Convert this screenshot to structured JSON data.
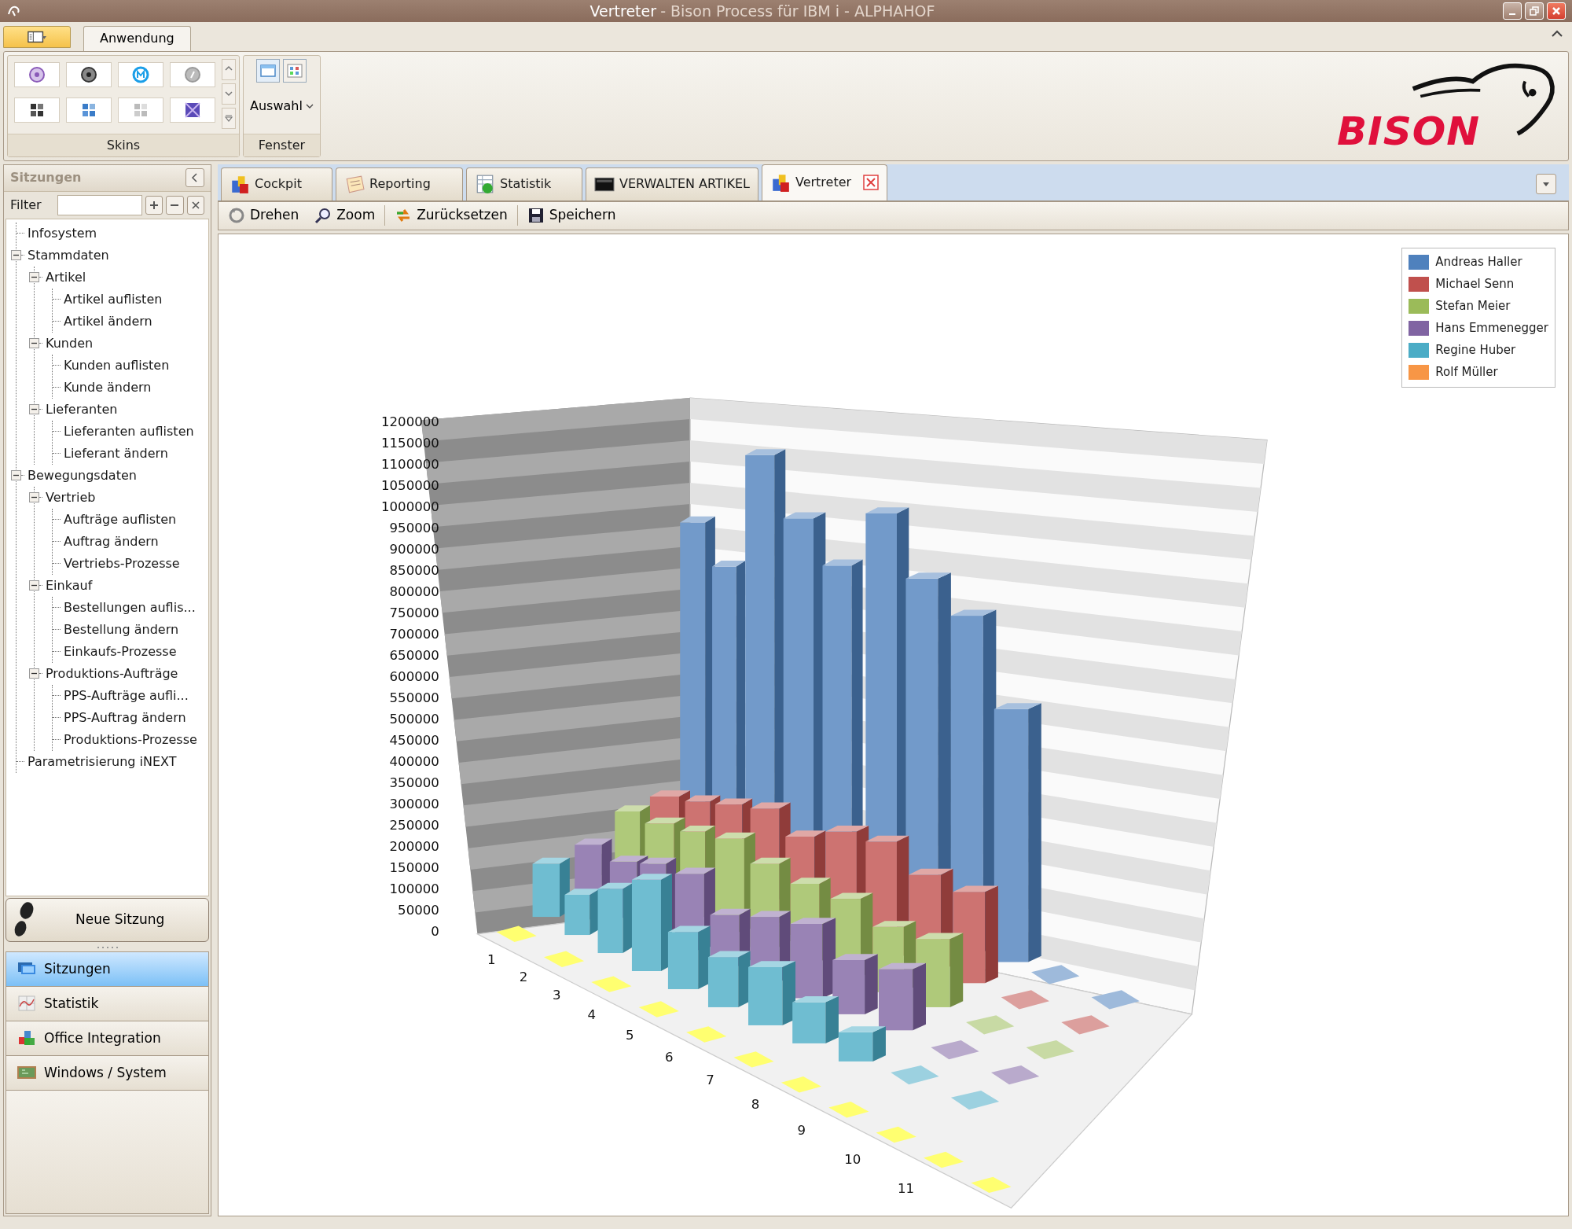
{
  "window": {
    "title": "Vertreter",
    "subtitle": "- Bison Process für IBM i - ALPHAHOF"
  },
  "ribbon": {
    "tabs": [
      {
        "label": "Anwendung",
        "selected": true
      }
    ],
    "groups": [
      {
        "label": "Skins"
      },
      {
        "label": "Fenster",
        "button": "Auswahl"
      }
    ],
    "logo": "BISON"
  },
  "sidebar": {
    "title": "Sitzungen",
    "filter_label": "Filter",
    "tree": [
      {
        "label": "Infosystem"
      },
      {
        "label": "Stammdaten",
        "expanded": true,
        "children": [
          {
            "label": "Artikel",
            "expanded": true,
            "children": [
              {
                "label": "Artikel auflisten"
              },
              {
                "label": "Artikel ändern"
              }
            ]
          },
          {
            "label": "Kunden",
            "expanded": true,
            "children": [
              {
                "label": "Kunden auflisten"
              },
              {
                "label": "Kunde ändern"
              }
            ]
          },
          {
            "label": "Lieferanten",
            "expanded": true,
            "children": [
              {
                "label": "Lieferanten auflisten"
              },
              {
                "label": "Lieferant ändern"
              }
            ]
          }
        ]
      },
      {
        "label": "Bewegungsdaten",
        "expanded": true,
        "children": [
          {
            "label": "Vertrieb",
            "expanded": true,
            "children": [
              {
                "label": "Aufträge auflisten"
              },
              {
                "label": "Auftrag ändern"
              },
              {
                "label": "Vertriebs-Prozesse"
              }
            ]
          },
          {
            "label": "Einkauf",
            "expanded": true,
            "children": [
              {
                "label": "Bestellungen auflis..."
              },
              {
                "label": "Bestellung ändern"
              },
              {
                "label": "Einkaufs-Prozesse"
              }
            ]
          },
          {
            "label": "Produktions-Aufträge",
            "expanded": true,
            "children": [
              {
                "label": "PPS-Aufträge aufli..."
              },
              {
                "label": "PPS-Auftrag ändern"
              },
              {
                "label": "Produktions-Prozesse"
              }
            ]
          }
        ]
      },
      {
        "label": "Parametrisierung iNEXT"
      }
    ],
    "new_session": "Neue Sitzung",
    "nav": [
      {
        "label": "Sitzungen",
        "selected": true
      },
      {
        "label": "Statistik",
        "selected": false
      },
      {
        "label": "Office Integration",
        "selected": false
      },
      {
        "label": "Windows / System",
        "selected": false
      }
    ]
  },
  "document_tabs": [
    {
      "label": "Cockpit",
      "selected": false,
      "closable": false
    },
    {
      "label": "Reporting",
      "selected": false,
      "closable": false
    },
    {
      "label": "Statistik",
      "selected": false,
      "closable": false
    },
    {
      "label": "VERWALTEN ARTIKEL",
      "selected": false,
      "closable": false
    },
    {
      "label": "Vertreter",
      "selected": true,
      "closable": true
    }
  ],
  "toolbar": [
    {
      "label": "Drehen"
    },
    {
      "label": "Zoom"
    },
    {
      "label": "Zurücksetzen"
    },
    {
      "label": "Speichern"
    }
  ],
  "chart": {
    "legend": [
      {
        "name": "Andreas Haller",
        "color": "#4f81bd"
      },
      {
        "name": "Michael Senn",
        "color": "#c0504d"
      },
      {
        "name": "Stefan Meier",
        "color": "#9bbb59"
      },
      {
        "name": "Hans Emmenegger",
        "color": "#8064a2"
      },
      {
        "name": "Regine Huber",
        "color": "#4bacc6"
      },
      {
        "name": "Rolf Müller",
        "color": "#f79646"
      }
    ],
    "y_axis_labels": [
      "1200000",
      "1150000",
      "1100000",
      "1050000",
      "1000000",
      "950000",
      "900000",
      "850000",
      "800000",
      "750000",
      "700000",
      "650000",
      "600000",
      "550000",
      "500000",
      "450000",
      "400000",
      "350000",
      "300000",
      "250000",
      "200000",
      "150000",
      "100000",
      "50000",
      "0"
    ],
    "x_axis_labels": [
      "1",
      "2",
      "3",
      "4",
      "5",
      "6",
      "7",
      "8",
      "9",
      "10",
      "11"
    ]
  }
}
